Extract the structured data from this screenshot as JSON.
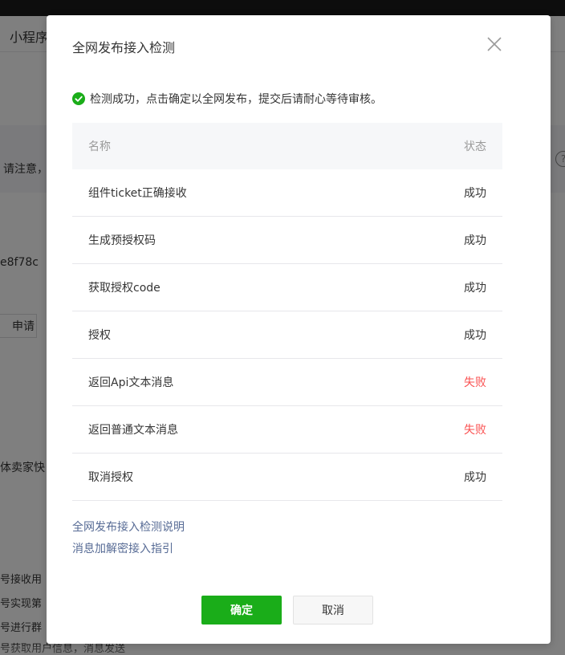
{
  "background": {
    "header_title": "小程序",
    "notice_text": "请注意，",
    "help_icon": "?",
    "code_text": "e8f78c",
    "apply_button": "申请",
    "seller_text": "体卖家快",
    "lines": [
      "号接收用",
      "号实现第",
      "号进行群",
      "号获取用户信息，消息发送"
    ]
  },
  "dialog": {
    "title": "全网发布接入检测",
    "result_text": "检测成功，点击确定以全网发布，提交后请耐心等待审核。",
    "table": {
      "headers": {
        "name": "名称",
        "status": "状态"
      },
      "rows": [
        {
          "name": "组件ticket正确接收",
          "status": "成功",
          "fail": false
        },
        {
          "name": "生成预授权码",
          "status": "成功",
          "fail": false
        },
        {
          "name": "获取授权code",
          "status": "成功",
          "fail": false
        },
        {
          "name": "授权",
          "status": "成功",
          "fail": false
        },
        {
          "name": "返回Api文本消息",
          "status": "失败",
          "fail": true
        },
        {
          "name": "返回普通文本消息",
          "status": "失败",
          "fail": true
        },
        {
          "name": "取消授权",
          "status": "成功",
          "fail": false
        }
      ]
    },
    "links": {
      "guide": "全网发布接入检测说明",
      "encrypt": "消息加解密接入指引"
    },
    "buttons": {
      "confirm": "确定",
      "cancel": "取消"
    },
    "colors": {
      "success": "#1aad19",
      "fail": "#fa5151",
      "link": "#576b95"
    }
  }
}
